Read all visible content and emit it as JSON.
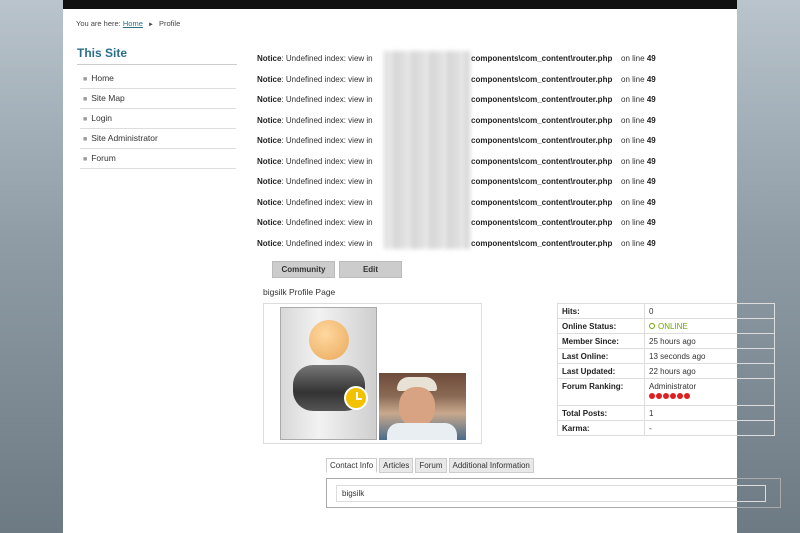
{
  "breadcrumb": {
    "prefix": "You are here:",
    "home": "Home",
    "separator": "►",
    "current": "Profile"
  },
  "sidebar": {
    "title": "This Site",
    "items": [
      {
        "label": "Home"
      },
      {
        "label": "Site Map"
      },
      {
        "label": "Login"
      },
      {
        "label": "Site Administrator"
      },
      {
        "label": "Forum"
      }
    ]
  },
  "notice": {
    "label": "Notice",
    "message": ": Undefined index: view in",
    "path": "components\\com_content\\router.php",
    "line_text": "on line",
    "line": "49",
    "count": 10
  },
  "buttons": {
    "community": "Community",
    "edit": "Edit"
  },
  "profile": {
    "title": "bigsilk Profile Page",
    "stats": [
      {
        "key": "Hits:",
        "value": "0"
      },
      {
        "key": "Online Status:",
        "value": "ONLINE"
      },
      {
        "key": "Member Since:",
        "value": "25 hours ago"
      },
      {
        "key": "Last Online:",
        "value": "13 seconds ago"
      },
      {
        "key": "Last Updated:",
        "value": "22 hours ago"
      },
      {
        "key": "Forum Ranking:",
        "value": "Administrator"
      },
      {
        "key": "Total Posts:",
        "value": "1"
      },
      {
        "key": "Karma:",
        "value": "-"
      }
    ],
    "status_color": "#6fa600",
    "ranking_stars": 6
  },
  "tabs": [
    {
      "label": "Contact Info"
    },
    {
      "label": "Articles"
    },
    {
      "label": "Forum"
    },
    {
      "label": "Additional Information"
    }
  ],
  "contact": {
    "value": "bigsilk"
  }
}
